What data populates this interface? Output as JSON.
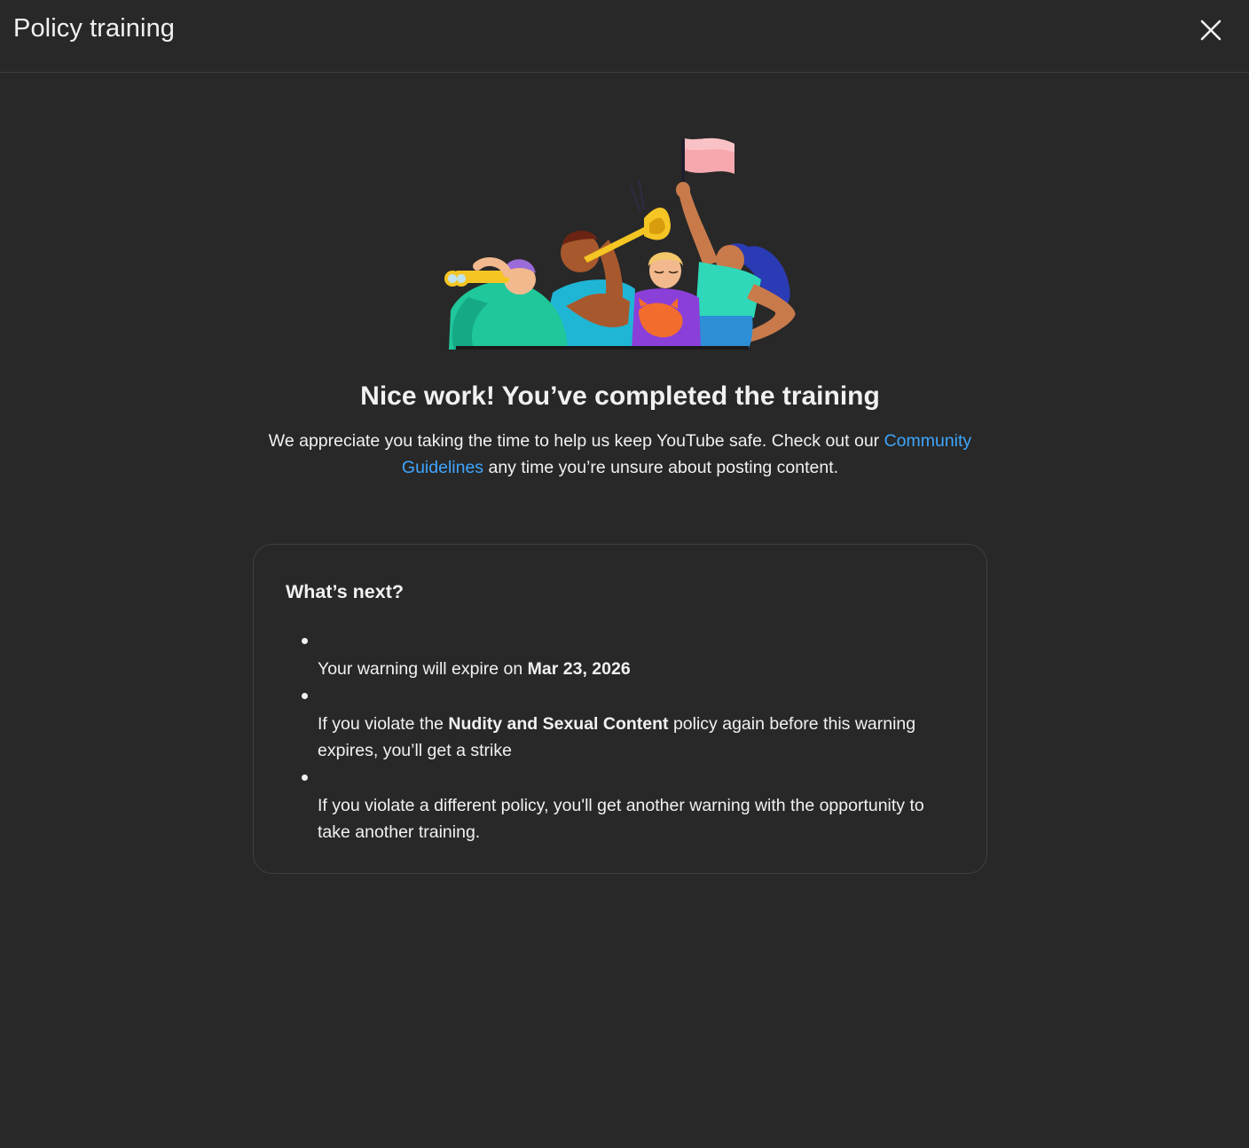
{
  "header": {
    "title": "Policy training"
  },
  "hero": {
    "title": "Nice work! You’ve completed the training",
    "desc_before": "We appreciate you taking the time to help us keep YouTube safe. Check out our ",
    "desc_link": "Community Guidelines",
    "desc_after": " any time you’re unsure about posting content."
  },
  "next": {
    "title": "What’s next?",
    "items": [
      {
        "before": "Your warning will expire on ",
        "bold": "Mar 23, 2026",
        "after": ""
      },
      {
        "before": "If you violate the ",
        "bold": "Nudity and Sexual Content",
        "after": " policy again before this warning expires, you’ll get a strike"
      },
      {
        "before": "If you violate a different policy, you'll get another warning with the opportunity to take another training.",
        "bold": "",
        "after": ""
      }
    ]
  },
  "colors": {
    "background": "#282828",
    "text": "#f1f1f1",
    "link": "#3ea6ff",
    "border": "#3f3f3f"
  },
  "icons": {
    "close": "close-icon"
  }
}
